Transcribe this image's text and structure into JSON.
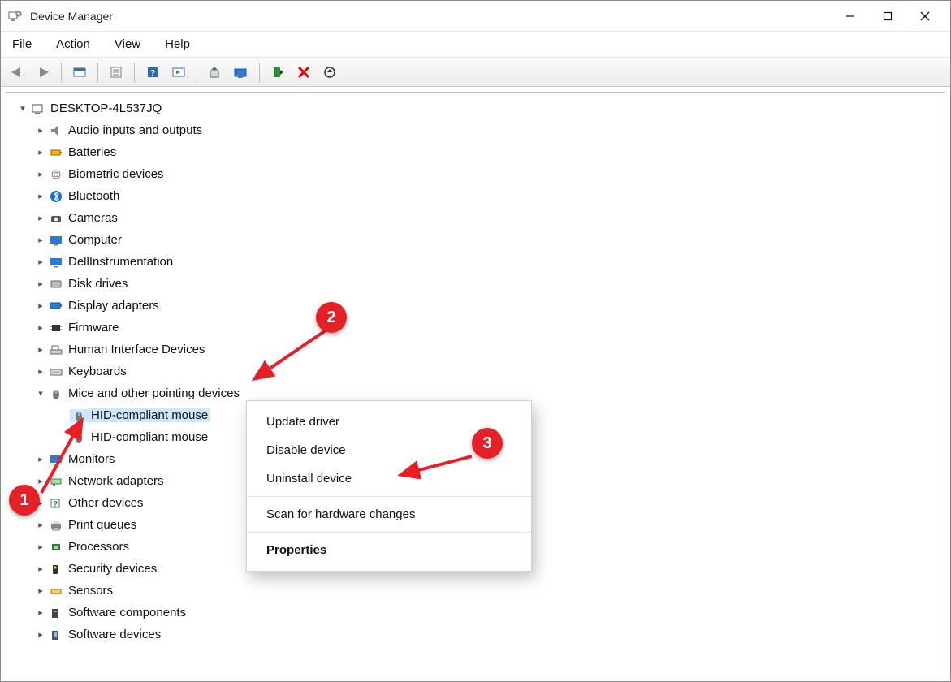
{
  "window": {
    "title": "Device Manager"
  },
  "menu": {
    "file": "File",
    "action": "Action",
    "view": "View",
    "help": "Help"
  },
  "tree": {
    "root": "DESKTOP-4L537JQ",
    "categories": [
      "Audio inputs and outputs",
      "Batteries",
      "Biometric devices",
      "Bluetooth",
      "Cameras",
      "Computer",
      "DellInstrumentation",
      "Disk drives",
      "Display adapters",
      "Firmware",
      "Human Interface Devices",
      "Keyboards",
      "Mice and other pointing devices",
      "Monitors",
      "Network adapters",
      "Other devices",
      "Print queues",
      "Processors",
      "Security devices",
      "Sensors",
      "Software components",
      "Software devices"
    ],
    "mice_children": [
      "HID-compliant mouse",
      "HID-compliant mouse"
    ]
  },
  "context_menu": {
    "update": "Update driver",
    "disable": "Disable device",
    "uninstall": "Uninstall device",
    "scan": "Scan for hardware changes",
    "properties": "Properties"
  },
  "annotations": {
    "a1": "1",
    "a2": "2",
    "a3": "3"
  }
}
